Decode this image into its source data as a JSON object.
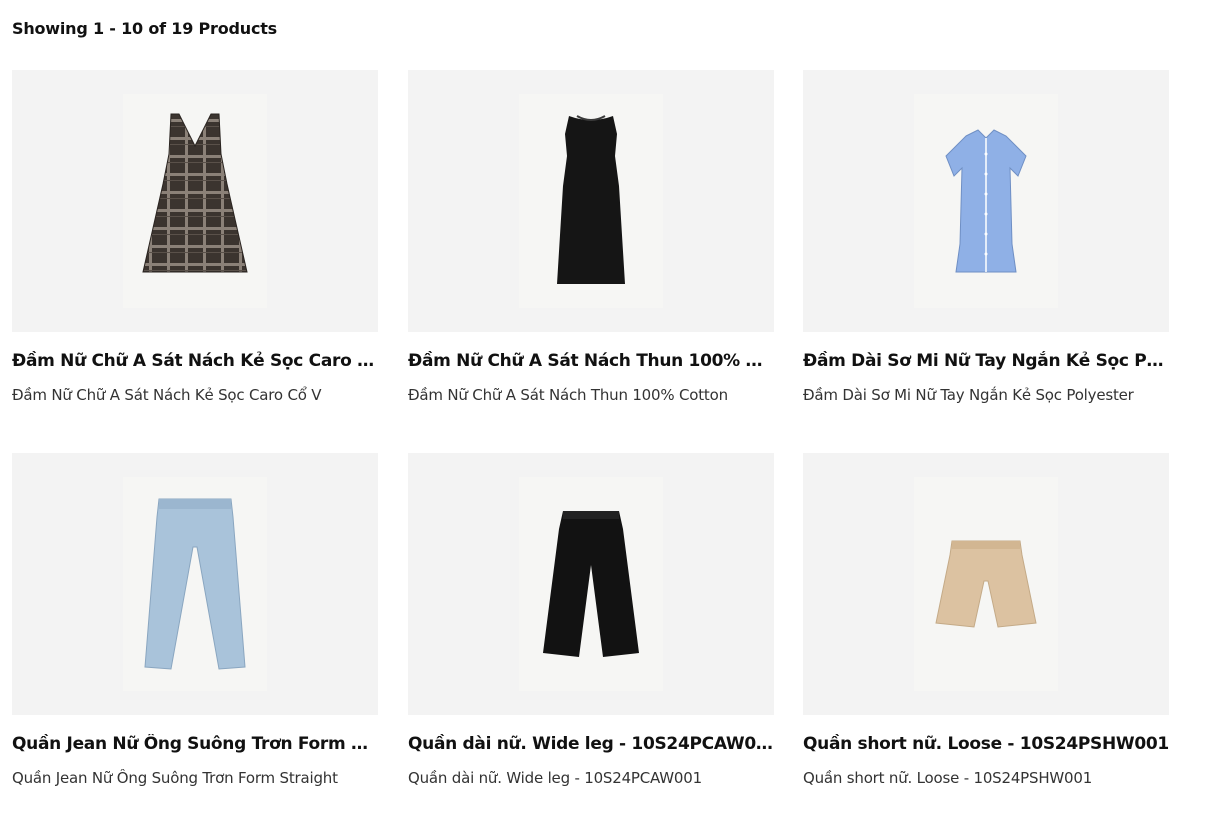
{
  "listing": {
    "result_count": "Showing 1 - 10 of 19 Products"
  },
  "products": [
    {
      "title": "Đầm Nữ Chữ A Sát Nách Kẻ Sọc Caro Cổ V",
      "description": "Đầm Nữ Chữ A Sát Nách Kẻ Sọc Caro Cổ V",
      "icon": "plaid-dress-icon",
      "color": "#3b342f"
    },
    {
      "title": "Đầm Nữ Chữ A Sát Nách Thun 100% Cotton",
      "description": "Đầm Nữ Chữ A Sát Nách Thun 100% Cotton",
      "icon": "black-dress-icon",
      "color": "#151515"
    },
    {
      "title": "Đầm Dài Sơ Mi Nữ Tay Ngắn Kẻ Sọc Polyester",
      "description": "Đầm Dài Sơ Mi Nữ Tay Ngắn Kẻ Sọc Polyester",
      "icon": "shirt-dress-icon",
      "color": "#8fb0e6"
    },
    {
      "title": "Quần Jean Nữ Ống Suông Trơn Form Straight",
      "description": "Quần Jean Nữ Ống Suông Trơn Form Straight",
      "icon": "jeans-icon",
      "color": "#a9c3da"
    },
    {
      "title": "Quần dài nữ. Wide leg - 10S24PCAW001",
      "description": "Quần dài nữ. Wide leg - 10S24PCAW001",
      "icon": "wide-leg-pants-icon",
      "color": "#121212"
    },
    {
      "title": "Quần short nữ. Loose - 10S24PSHW001",
      "description": "Quần short nữ. Loose - 10S24PSHW001",
      "icon": "shorts-icon",
      "color": "#dcc2a1"
    }
  ]
}
